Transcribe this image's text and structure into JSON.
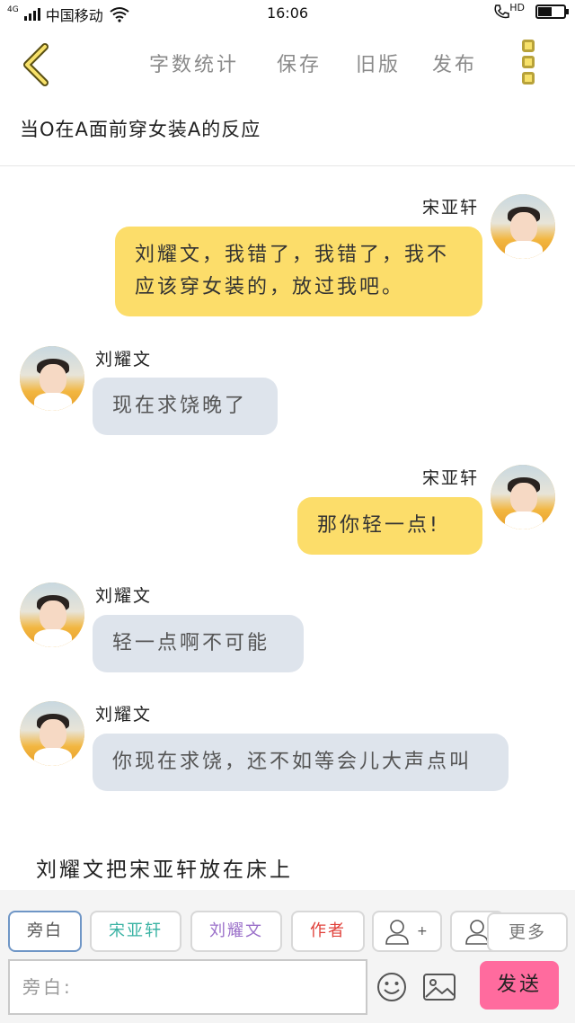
{
  "status_bar": {
    "network": "4G",
    "carrier": "中国移动",
    "time": "16:06",
    "hd_label": "HD",
    "battery_level": 0.55
  },
  "toolbar": {
    "word_count_label": "字数统计",
    "save_label": "保存",
    "old_version_label": "旧版",
    "publish_label": "发布"
  },
  "story": {
    "title": "当O在A面前穿女装A的反应"
  },
  "messages": [
    {
      "speaker": "宋亚轩",
      "side": "right",
      "text": "刘耀文，我错了，我错了，我不应该穿女装的，放过我吧。"
    },
    {
      "speaker": "刘耀文",
      "side": "left",
      "text": "现在求饶晚了"
    },
    {
      "speaker": "宋亚轩",
      "side": "right",
      "text": "那你轻一点!"
    },
    {
      "speaker": "刘耀文",
      "side": "left",
      "text": "轻一点啊不可能"
    },
    {
      "speaker": "刘耀文",
      "side": "left",
      "text": "你现在求饶，还不如等会儿大声点叫"
    }
  ],
  "narration": "刘耀文把宋亚轩放在床上",
  "roles": [
    {
      "label": "旁白",
      "color": "#555555"
    },
    {
      "label": "宋亚轩",
      "color": "#3bb3a4"
    },
    {
      "label": "刘耀文",
      "color": "#9a6fc9"
    },
    {
      "label": "作者",
      "color": "#e0403a"
    },
    {
      "label": "+",
      "color": "#555555"
    }
  ],
  "more_label": "更多",
  "input": {
    "placeholder": "旁白:"
  },
  "send_label": "发送",
  "colors": {
    "my_bubble": "#fcdd6a",
    "other_bubble": "#dee4ec",
    "send_button": "#ff6b9e",
    "accent_yellow": "#f7e16a"
  }
}
